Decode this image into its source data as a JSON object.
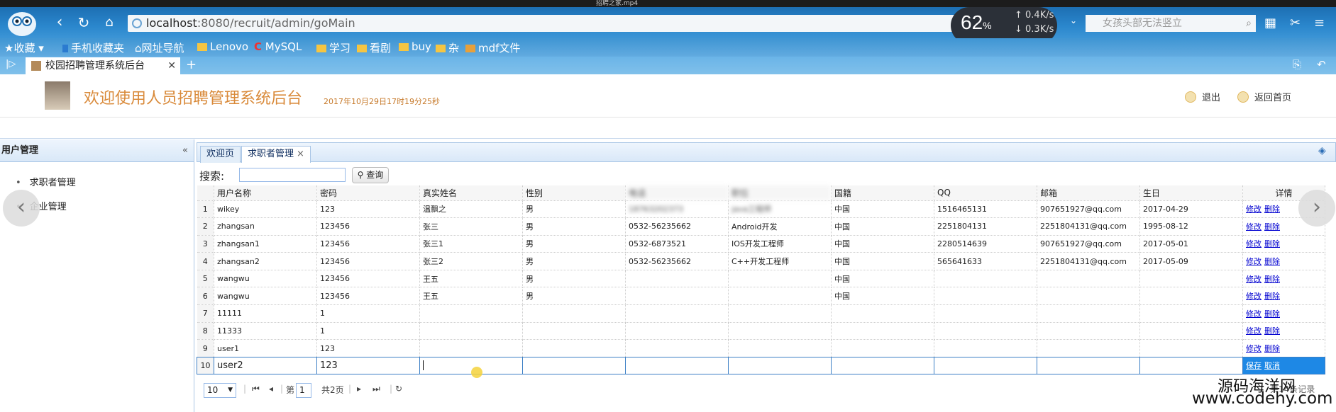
{
  "window": {
    "title": "招聘之家.mp4"
  },
  "browser": {
    "url_host": "localhost",
    "url_path": ":8080/recruit/admin/goMain",
    "speed": {
      "percent": "62",
      "unit": "%",
      "up": "0.4K/s",
      "down": "0.3K/s"
    },
    "search_placeholder": "女孩头部无法竖立",
    "bookmarks": [
      "收藏",
      "手机收藏夹",
      "网址导航",
      "Lenovo",
      "MySQL",
      "学习",
      "看剧",
      "buy",
      "杂",
      "mdf文件"
    ],
    "tab_title": "校园招聘管理系统后台"
  },
  "header": {
    "welcome": "欢迎使用人员招聘管理系统后台",
    "datetime": "2017年10月29日17时19分25秒",
    "logout": "退出",
    "home": "返回首页"
  },
  "west": {
    "title": "用户管理",
    "items": [
      "求职者管理",
      "企业管理"
    ]
  },
  "center": {
    "tabs": [
      "欢迎页",
      "求职者管理"
    ],
    "search_label": "搜索:",
    "query_button": "查询",
    "columns": [
      "用户名称",
      "密码",
      "真实姓名",
      "性别",
      "电话",
      "职位",
      "国籍",
      "QQ",
      "邮箱",
      "生日",
      "详情"
    ],
    "ops": {
      "edit": "修改",
      "delete": "删除",
      "save": "保存",
      "cancel": "取消"
    },
    "rows": [
      [
        "wikey",
        "123",
        "温飘之",
        "男",
        "18763202373",
        "java工程师",
        "中国",
        "1516465131",
        "907651927@qq.com",
        "2017-04-29"
      ],
      [
        "zhangsan",
        "123456",
        "张三",
        "男",
        "0532-56235662",
        "Android开发",
        "中国",
        "2251804131",
        "2251804131@qq.com",
        "1995-08-12"
      ],
      [
        "zhangsan1",
        "123456",
        "张三1",
        "男",
        "0532-6873521",
        "IOS开发工程师",
        "中国",
        "2280514639",
        "907651927@qq.com",
        "2017-05-01"
      ],
      [
        "zhangsan2",
        "123456",
        "张三2",
        "男",
        "0532-56235662",
        "C++开发工程师",
        "中国",
        "565641633",
        "2251804131@qq.com",
        "2017-05-09"
      ],
      [
        "wangwu",
        "123456",
        "王五",
        "男",
        "",
        "",
        "中国",
        "",
        "",
        ""
      ],
      [
        "wangwu",
        "123456",
        "王五",
        "男",
        "",
        "",
        "中国",
        "",
        "",
        ""
      ],
      [
        "11111",
        "1",
        "",
        "",
        "",
        "",
        "",
        "",
        "",
        ""
      ],
      [
        "11333",
        "1",
        "",
        "",
        "",
        "",
        "",
        "",
        "",
        ""
      ],
      [
        "user1",
        "123",
        "",
        "",
        "",
        "",
        "",
        "",
        "",
        ""
      ],
      [
        "user2",
        "123",
        "",
        "",
        "",
        "",
        "",
        "",
        "",
        ""
      ]
    ],
    "pager": {
      "page_size": "10",
      "page_prefix": "第",
      "page_value": "1",
      "page_total": "共2页",
      "records": "共14条记录"
    }
  },
  "watermark": {
    "line1": "源码海洋网",
    "line2": "www.codehy.com"
  },
  "colors": {
    "brand_blue": "#2a86cc",
    "accent_orange": "#d98a3a",
    "link": "#0000d0"
  }
}
